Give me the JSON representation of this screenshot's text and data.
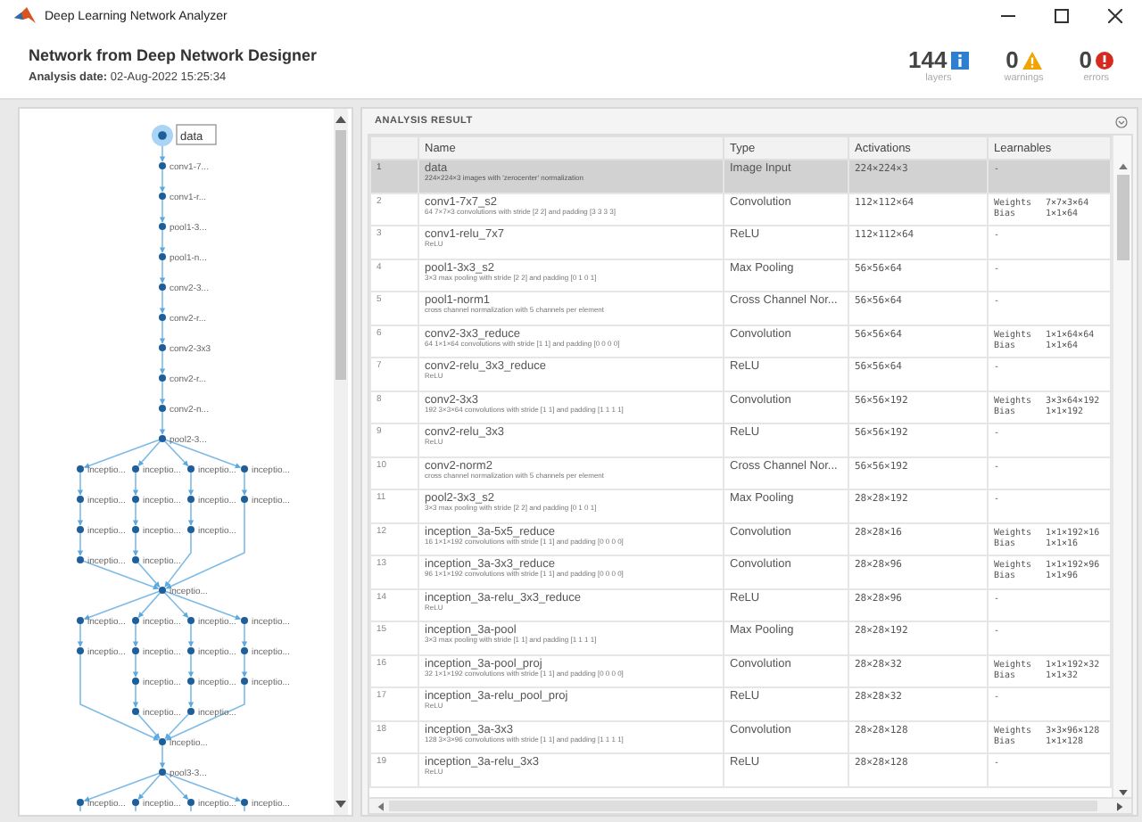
{
  "window": {
    "title": "Deep Learning Network Analyzer"
  },
  "header": {
    "title": "Network from Deep Network Designer",
    "analysis_date": "**Analysis date:** 02-Aug-2022 15:25:34",
    "counters": [
      {
        "kind": "info",
        "value": "144",
        "label": "layers"
      },
      {
        "kind": "warning",
        "value": "0",
        "label": "warnings"
      },
      {
        "kind": "error",
        "value": "0",
        "label": "errors"
      }
    ]
  },
  "graph": {
    "stages": [
      {
        "kind": "node",
        "node": {
          "label": "data",
          "selected": true
        }
      },
      {
        "kind": "node",
        "node": {
          "label": "conv1-7...",
          "selected": false
        }
      },
      {
        "kind": "node",
        "node": {
          "label": "conv1-r...",
          "selected": false
        }
      },
      {
        "kind": "node",
        "node": {
          "label": "pool1-3...",
          "selected": false
        }
      },
      {
        "kind": "node",
        "node": {
          "label": "pool1-n...",
          "selected": false
        }
      },
      {
        "kind": "node",
        "node": {
          "label": "conv2-3...",
          "selected": false
        }
      },
      {
        "kind": "node",
        "node": {
          "label": "conv2-r...",
          "selected": false
        }
      },
      {
        "kind": "node",
        "node": {
          "label": "conv2-3x3",
          "selected": false
        }
      },
      {
        "kind": "node",
        "node": {
          "label": "conv2-r...",
          "selected": false
        }
      },
      {
        "kind": "node",
        "node": {
          "label": "conv2-n...",
          "selected": false
        }
      },
      {
        "kind": "node",
        "node": {
          "label": "pool2-3...",
          "selected": false
        }
      },
      {
        "kind": "branches",
        "branches": [
          [
            {
              "label": "inceptio...",
              "selected": false
            },
            {
              "label": "inceptio...",
              "selected": false
            },
            {
              "label": "inceptio...",
              "selected": false
            },
            {
              "label": "inceptio...",
              "selected": false
            }
          ],
          [
            {
              "label": "inceptio...",
              "selected": false
            },
            {
              "label": "inceptio...",
              "selected": false
            },
            {
              "label": "inceptio...",
              "selected": false
            },
            {
              "label": "inceptio...",
              "selected": false
            }
          ],
          [
            {
              "label": "inceptio...",
              "selected": false
            },
            {
              "label": "inceptio...",
              "selected": false
            },
            {
              "label": "inceptio...",
              "selected": false
            }
          ],
          [
            {
              "label": "inceptio...",
              "selected": false
            },
            {
              "label": "inceptio...",
              "selected": false
            }
          ]
        ]
      },
      {
        "kind": "node",
        "node": {
          "label": "inceptio...",
          "selected": false
        }
      },
      {
        "kind": "branches",
        "branches": [
          [
            {
              "label": "inceptio...",
              "selected": false
            },
            {
              "label": "inceptio...",
              "selected": false
            }
          ],
          [
            {
              "label": "inceptio...",
              "selected": false
            },
            {
              "label": "inceptio...",
              "selected": false
            },
            {
              "label": "inceptio...",
              "selected": false
            },
            {
              "label": "inceptio...",
              "selected": false
            }
          ],
          [
            {
              "label": "inceptio...",
              "selected": false
            },
            {
              "label": "inceptio...",
              "selected": false
            },
            {
              "label": "inceptio...",
              "selected": false
            },
            {
              "label": "inceptio...",
              "selected": false
            }
          ],
          [
            {
              "label": "inceptio...",
              "selected": false
            },
            {
              "label": "inceptio...",
              "selected": false
            },
            {
              "label": "inceptio...",
              "selected": false
            }
          ]
        ]
      },
      {
        "kind": "node",
        "node": {
          "label": "inceptio...",
          "selected": false
        }
      },
      {
        "kind": "node",
        "node": {
          "label": "pool3-3...",
          "selected": false
        }
      },
      {
        "kind": "branches",
        "branches": [
          [
            {
              "label": "inceptio...",
              "selected": false
            }
          ],
          [
            {
              "label": "inceptio...",
              "selected": false
            }
          ],
          [
            {
              "label": "inceptio...",
              "selected": false
            }
          ],
          [
            {
              "label": "inceptio...",
              "selected": false
            }
          ]
        ]
      }
    ]
  },
  "results": {
    "title": "ANALYSIS RESULT",
    "columns": [
      "Name",
      "Type",
      "Activations",
      "Learnables"
    ],
    "rows": [
      {
        "index": "1",
        "name": "data",
        "description": "224×224×3 images with 'zerocenter' normalization",
        "type": "Image Input",
        "activations": "224×224×3",
        "learnables": "-",
        "selected": true
      },
      {
        "index": "2",
        "name": "conv1-7x7_s2",
        "description": "64 7×7×3 convolutions with stride [2 2] and padding [3 3 3 3]",
        "type": "Convolution",
        "activations": "112×112×64",
        "learnables": [
          {
            "name": "Weights",
            "value": "7×7×3×64"
          },
          {
            "name": "Bias",
            "value": "1×1×64"
          }
        ],
        "selected": false
      },
      {
        "index": "3",
        "name": "conv1-relu_7x7",
        "description": "ReLU",
        "type": "ReLU",
        "activations": "112×112×64",
        "learnables": "-",
        "selected": false
      },
      {
        "index": "4",
        "name": "pool1-3x3_s2",
        "description": "3×3 max pooling with stride [2 2] and padding [0 1 0 1]",
        "type": "Max Pooling",
        "activations": "56×56×64",
        "learnables": "-",
        "selected": false
      },
      {
        "index": "5",
        "name": "pool1-norm1",
        "description": "cross channel normalization with 5 channels per element",
        "type": "Cross Channel Nor...",
        "activations": "56×56×64",
        "learnables": "-",
        "selected": false
      },
      {
        "index": "6",
        "name": "conv2-3x3_reduce",
        "description": "64 1×1×64 convolutions with stride [1 1] and padding [0 0 0 0]",
        "type": "Convolution",
        "activations": "56×56×64",
        "learnables": [
          {
            "name": "Weights",
            "value": "1×1×64×64"
          },
          {
            "name": "Bias",
            "value": "1×1×64"
          }
        ],
        "selected": false
      },
      {
        "index": "7",
        "name": "conv2-relu_3x3_reduce",
        "description": "ReLU",
        "type": "ReLU",
        "activations": "56×56×64",
        "learnables": "-",
        "selected": false
      },
      {
        "index": "8",
        "name": "conv2-3x3",
        "description": "192 3×3×64 convolutions with stride [1 1] and padding [1 1 1 1]",
        "type": "Convolution",
        "activations": "56×56×192",
        "learnables": [
          {
            "name": "Weights",
            "value": "3×3×64×192"
          },
          {
            "name": "Bias",
            "value": "1×1×192"
          }
        ],
        "selected": false
      },
      {
        "index": "9",
        "name": "conv2-relu_3x3",
        "description": "ReLU",
        "type": "ReLU",
        "activations": "56×56×192",
        "learnables": "-",
        "selected": false
      },
      {
        "index": "10",
        "name": "conv2-norm2",
        "description": "cross channel normalization with 5 channels per element",
        "type": "Cross Channel Nor...",
        "activations": "56×56×192",
        "learnables": "-",
        "selected": false
      },
      {
        "index": "11",
        "name": "pool2-3x3_s2",
        "description": "3×3 max pooling with stride [2 2] and padding [0 1 0 1]",
        "type": "Max Pooling",
        "activations": "28×28×192",
        "learnables": "-",
        "selected": false
      },
      {
        "index": "12",
        "name": "inception_3a-5x5_reduce",
        "description": "16 1×1×192 convolutions with stride [1 1] and padding [0 0 0 0]",
        "type": "Convolution",
        "activations": "28×28×16",
        "learnables": [
          {
            "name": "Weights",
            "value": "1×1×192×16"
          },
          {
            "name": "Bias",
            "value": "1×1×16"
          }
        ],
        "selected": false
      },
      {
        "index": "13",
        "name": "inception_3a-3x3_reduce",
        "description": "96 1×1×192 convolutions with stride [1 1] and padding [0 0 0 0]",
        "type": "Convolution",
        "activations": "28×28×96",
        "learnables": [
          {
            "name": "Weights",
            "value": "1×1×192×96"
          },
          {
            "name": "Bias",
            "value": "1×1×96"
          }
        ],
        "selected": false
      },
      {
        "index": "14",
        "name": "inception_3a-relu_3x3_reduce",
        "description": "ReLU",
        "type": "ReLU",
        "activations": "28×28×96",
        "learnables": "-",
        "selected": false
      },
      {
        "index": "15",
        "name": "inception_3a-pool",
        "description": "3×3 max pooling with stride [1 1] and padding [1 1 1 1]",
        "type": "Max Pooling",
        "activations": "28×28×192",
        "learnables": "-",
        "selected": false
      },
      {
        "index": "16",
        "name": "inception_3a-pool_proj",
        "description": "32 1×1×192 convolutions with stride [1 1] and padding [0 0 0 0]",
        "type": "Convolution",
        "activations": "28×28×32",
        "learnables": [
          {
            "name": "Weights",
            "value": "1×1×192×32"
          },
          {
            "name": "Bias",
            "value": "1×1×32"
          }
        ],
        "selected": false
      },
      {
        "index": "17",
        "name": "inception_3a-relu_pool_proj",
        "description": "ReLU",
        "type": "ReLU",
        "activations": "28×28×32",
        "learnables": "-",
        "selected": false
      },
      {
        "index": "18",
        "name": "inception_3a-3x3",
        "description": "128 3×3×96 convolutions with stride [1 1] and padding [1 1 1 1]",
        "type": "Convolution",
        "activations": "28×28×128",
        "learnables": [
          {
            "name": "Weights",
            "value": "3×3×96×128"
          },
          {
            "name": "Bias",
            "value": "1×1×128"
          }
        ],
        "selected": false
      },
      {
        "index": "19",
        "name": "inception_3a-relu_3x3",
        "description": "ReLU",
        "type": "ReLU",
        "activations": "28×28×128",
        "learnables": "-",
        "selected": false
      }
    ]
  }
}
